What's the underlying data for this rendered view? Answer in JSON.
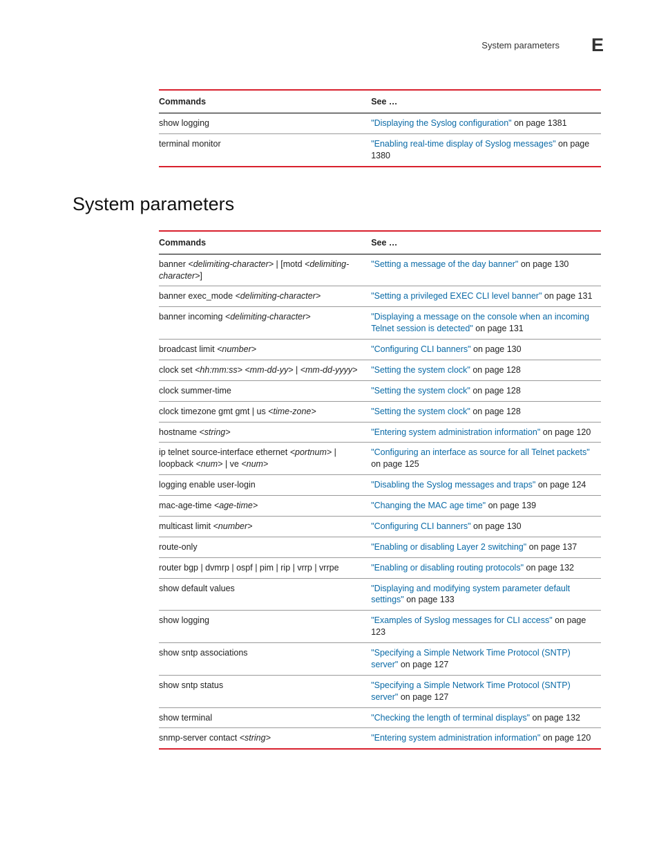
{
  "header": {
    "title": "System parameters",
    "letter": "E"
  },
  "section_title": "System parameters",
  "table_headers": {
    "commands": "Commands",
    "see": "See …"
  },
  "table1": {
    "rows": [
      {
        "cmd_segments": [
          {
            "t": "show logging",
            "i": false
          }
        ],
        "link": "\"Displaying the Syslog configuration\"",
        "suffix": " on page 1381"
      },
      {
        "cmd_segments": [
          {
            "t": "terminal monitor",
            "i": false
          }
        ],
        "link": "\"Enabling real-time display of Syslog messages\"",
        "suffix": " on page 1380"
      }
    ]
  },
  "table2": {
    "rows": [
      {
        "cmd_segments": [
          {
            "t": "banner ",
            "i": false
          },
          {
            "t": "<delimiting-character>",
            "i": true
          },
          {
            "t": " | [motd ",
            "i": false
          },
          {
            "t": "<delimiting-character>",
            "i": true
          },
          {
            "t": "]",
            "i": false
          }
        ],
        "link": "\"Setting a message of the day banner\"",
        "suffix": " on page 130"
      },
      {
        "cmd_segments": [
          {
            "t": "banner exec_mode ",
            "i": false
          },
          {
            "t": "<delimiting-character>",
            "i": true
          }
        ],
        "link": "\"Setting a privileged EXEC CLI level banner\"",
        "suffix": " on page 131"
      },
      {
        "cmd_segments": [
          {
            "t": "banner incoming ",
            "i": false
          },
          {
            "t": "<delimiting-character>",
            "i": true
          }
        ],
        "link": "\"Displaying a message on the console when an incoming Telnet session is detected\"",
        "suffix": " on page 131"
      },
      {
        "cmd_segments": [
          {
            "t": "broadcast limit ",
            "i": false
          },
          {
            "t": "<number>",
            "i": true
          }
        ],
        "link": "\"Configuring CLI banners\"",
        "suffix": " on page 130"
      },
      {
        "cmd_segments": [
          {
            "t": "clock set ",
            "i": false
          },
          {
            "t": "<hh:mm:ss> <mm-dd-yy>",
            "i": true
          },
          {
            "t": " | ",
            "i": false
          },
          {
            "t": "<mm-dd-yyyy>",
            "i": true
          }
        ],
        "link": "\"Setting the system clock\"",
        "suffix": " on page 128"
      },
      {
        "cmd_segments": [
          {
            "t": "clock summer-time",
            "i": false
          }
        ],
        "link": "\"Setting the system clock\"",
        "suffix": " on page 128"
      },
      {
        "cmd_segments": [
          {
            "t": "clock timezone  gmt gmt | us ",
            "i": false
          },
          {
            "t": "<time-zone>",
            "i": true
          }
        ],
        "link": "\"Setting the system clock\"",
        "suffix": " on page 128"
      },
      {
        "cmd_segments": [
          {
            "t": "hostname ",
            "i": false
          },
          {
            "t": "<string>",
            "i": true
          }
        ],
        "link": "\"Entering system administration information\"",
        "suffix": " on page 120"
      },
      {
        "cmd_segments": [
          {
            "t": "ip telnet source-interface ethernet ",
            "i": false
          },
          {
            "t": "<portnum>",
            "i": true
          },
          {
            "t": " | loopback ",
            "i": false
          },
          {
            "t": "<num>",
            "i": true
          },
          {
            "t": " | ve ",
            "i": false
          },
          {
            "t": "<num>",
            "i": true
          }
        ],
        "link": "\"Configuring an interface as source for all Telnet packets\"",
        "suffix": " on page 125"
      },
      {
        "cmd_segments": [
          {
            "t": "logging enable user-login",
            "i": false
          }
        ],
        "link": "\"Disabling the Syslog messages and traps\"",
        "suffix": " on page 124"
      },
      {
        "cmd_segments": [
          {
            "t": "mac-age-time ",
            "i": false
          },
          {
            "t": "<age-time>",
            "i": true
          }
        ],
        "link": "\"Changing the MAC age time\"",
        "suffix": " on page 139"
      },
      {
        "cmd_segments": [
          {
            "t": "multicast limit ",
            "i": false
          },
          {
            "t": "<number>",
            "i": true
          }
        ],
        "link": "\"Configuring CLI banners\"",
        "suffix": " on page 130"
      },
      {
        "cmd_segments": [
          {
            "t": "route-only",
            "i": false
          }
        ],
        "link": "\"Enabling or disabling Layer 2 switching\"",
        "suffix": " on page 137"
      },
      {
        "cmd_segments": [
          {
            "t": "router bgp | dvmrp | ospf | pim | rip | vrrp | vrrpe",
            "i": false
          }
        ],
        "link": "\"Enabling or disabling routing protocols\"",
        "suffix": " on page 132"
      },
      {
        "cmd_segments": [
          {
            "t": "show default values",
            "i": false
          }
        ],
        "link": "\"Displaying and modifying system parameter default settings\"",
        "suffix": " on page 133"
      },
      {
        "cmd_segments": [
          {
            "t": "show logging",
            "i": false
          }
        ],
        "link": "\"Examples of Syslog messages for CLI access\"",
        "suffix": " on page 123"
      },
      {
        "cmd_segments": [
          {
            "t": "show sntp associations",
            "i": false
          }
        ],
        "link": "\"Specifying a Simple Network Time Protocol (SNTP) server\"",
        "suffix": " on page 127"
      },
      {
        "cmd_segments": [
          {
            "t": "show sntp status",
            "i": false
          }
        ],
        "link": "\"Specifying a Simple Network Time Protocol (SNTP) server\"",
        "suffix": " on page 127"
      },
      {
        "cmd_segments": [
          {
            "t": "show terminal",
            "i": false
          }
        ],
        "link": "\"Checking the length of terminal displays\"",
        "suffix": " on page 132"
      },
      {
        "cmd_segments": [
          {
            "t": "snmp-server contact ",
            "i": false
          },
          {
            "t": "<string>",
            "i": true
          }
        ],
        "link": "\"Entering system administration information\"",
        "suffix": " on page 120"
      }
    ]
  }
}
